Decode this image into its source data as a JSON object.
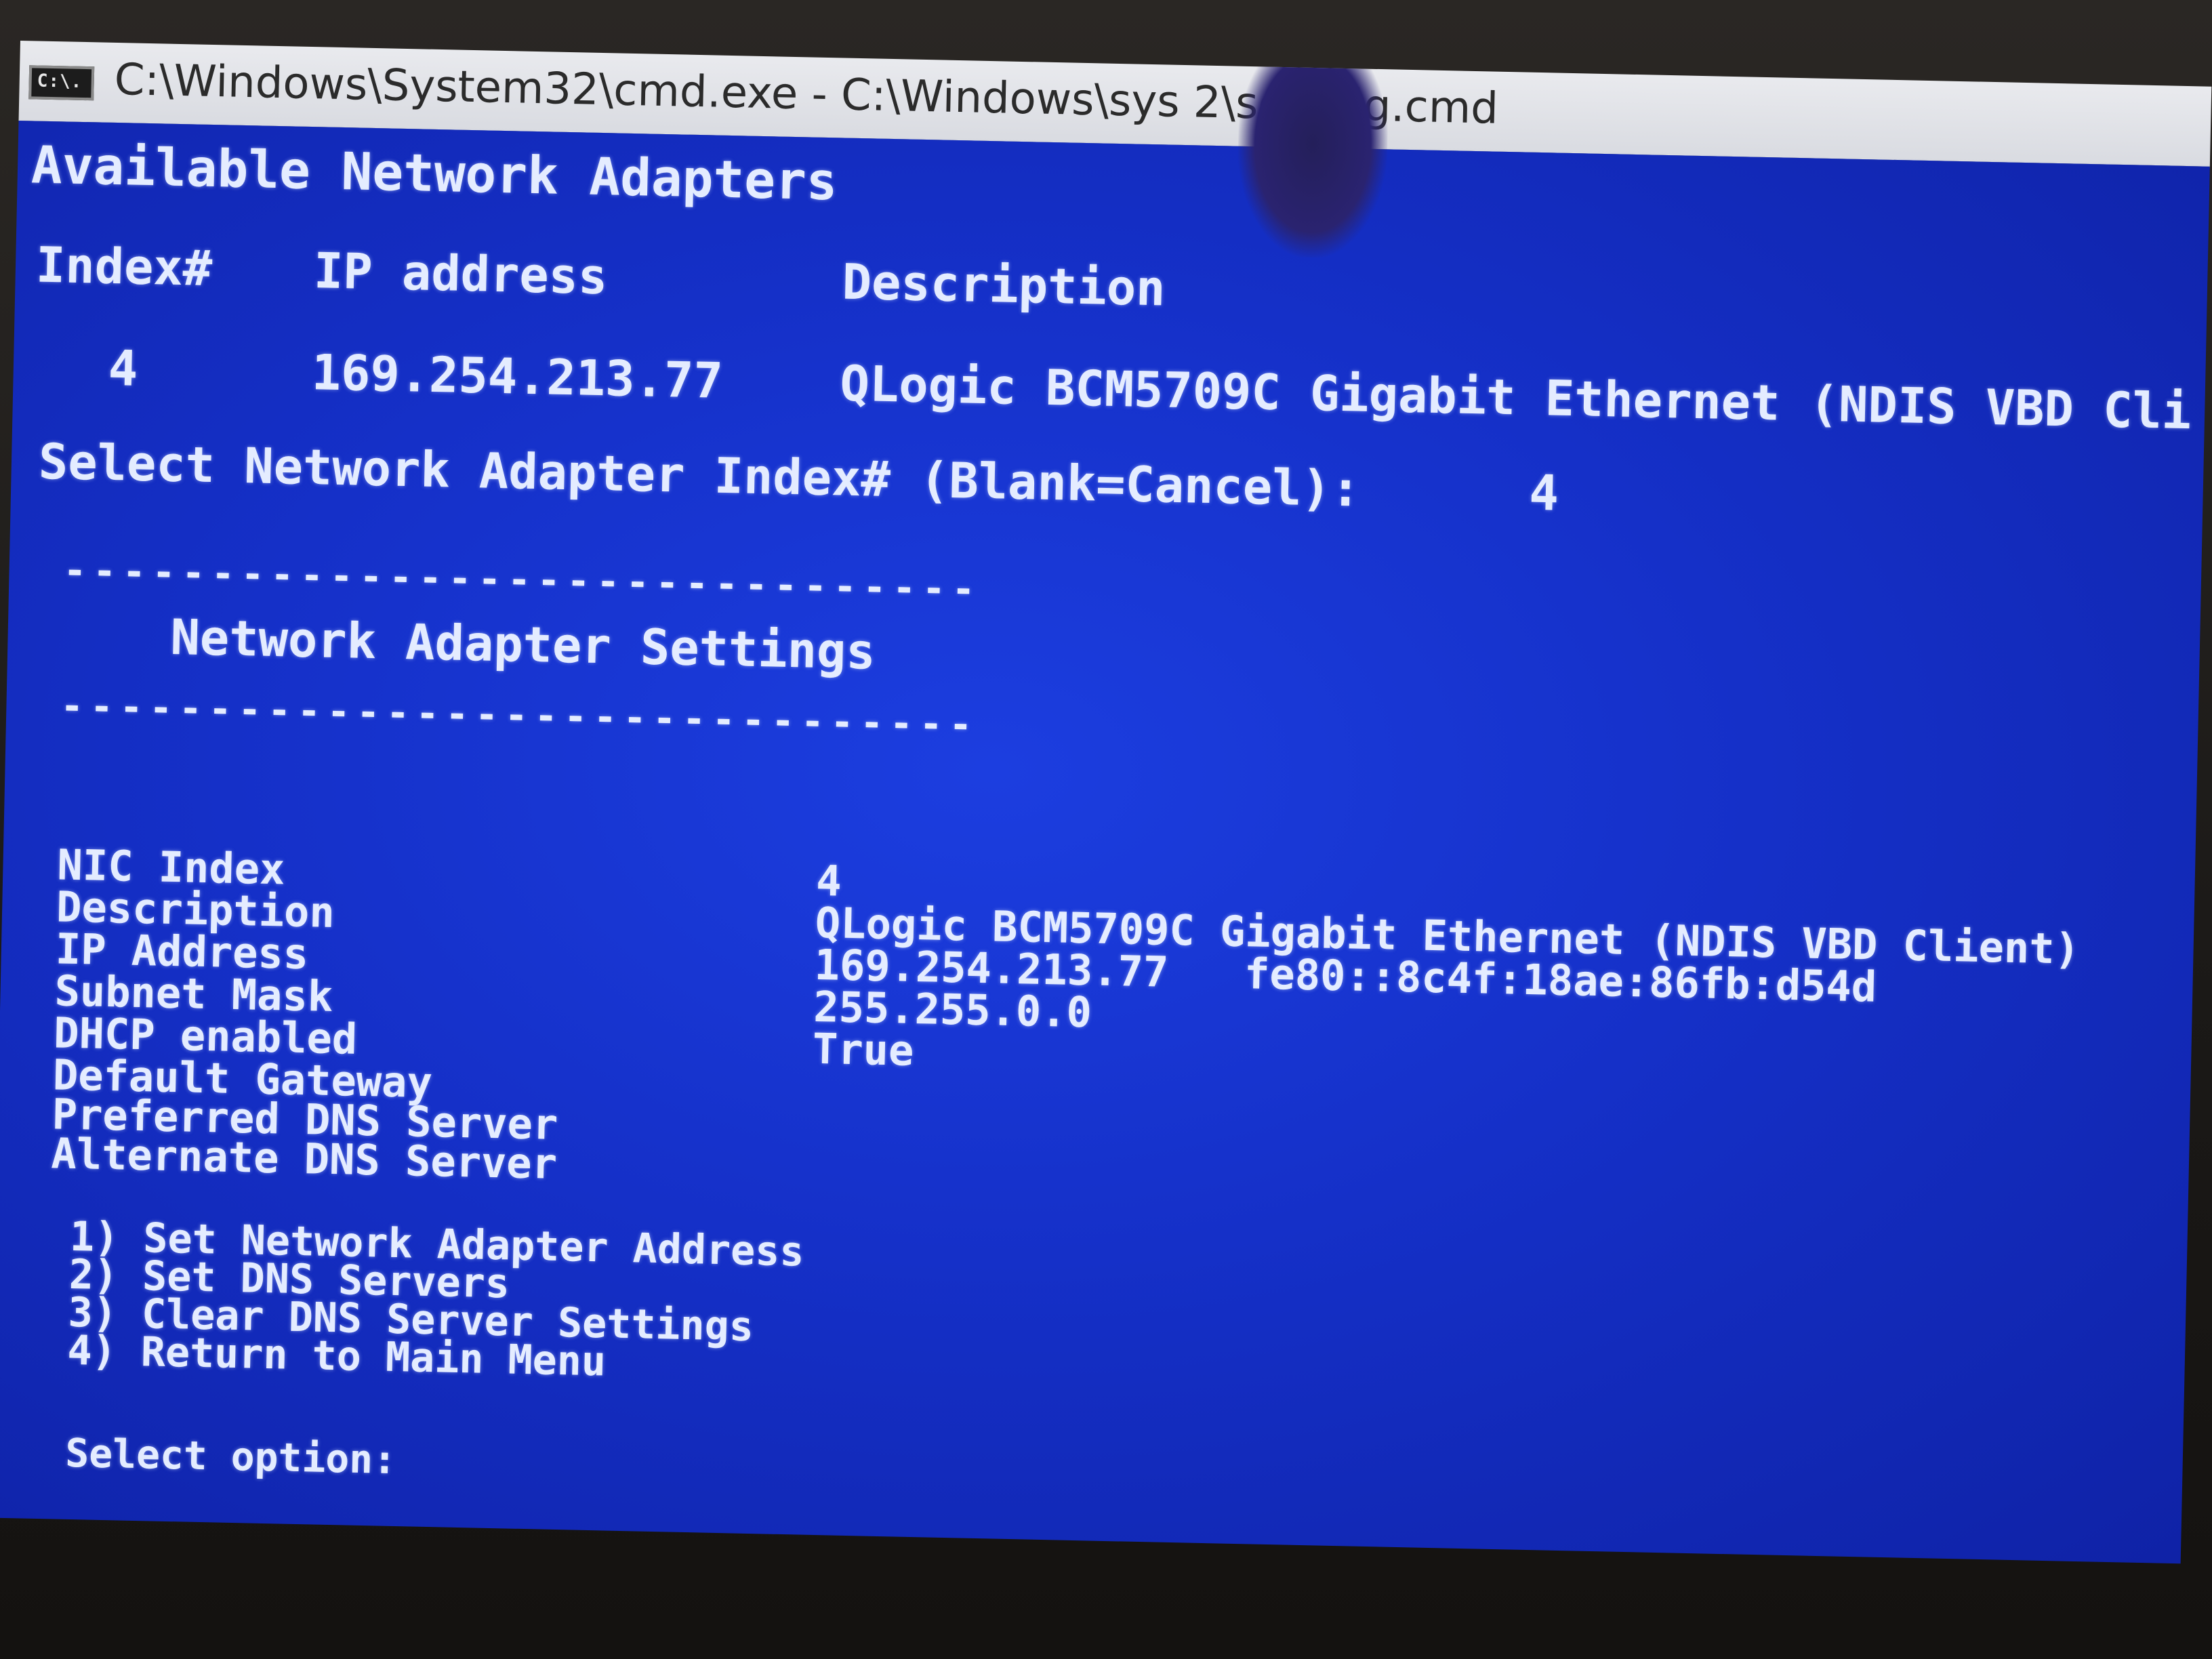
{
  "window": {
    "title": "C:\\Windows\\System32\\cmd.exe - C:\\Windows\\sys    2\\sconfig.cmd",
    "icon": "cmd-icon",
    "icon_text": "C:\\."
  },
  "console": {
    "heading": "Available Network Adapters",
    "table_headers": [
      "Index#",
      "IP address",
      "Description"
    ],
    "adapter_row": {
      "index": "4",
      "ip": "169.254.213.77",
      "description": "QLogic BCM5709C Gigabit Ethernet (NDIS VBD Cli"
    },
    "select_prompt": "Select Network Adapter Index# (Blank=Cancel):",
    "select_value": "4",
    "separator": "-------------------------------",
    "settings_title": "Network Adapter Settings",
    "settings": [
      {
        "label": "NIC Index",
        "value": "4"
      },
      {
        "label": "Description",
        "value": "QLogic BCM5709C Gigabit Ethernet (NDIS VBD Client)"
      },
      {
        "label": "IP Address",
        "value": "169.254.213.77   fe80::8c4f:18ae:86fb:d54d"
      },
      {
        "label": "Subnet Mask",
        "value": "255.255.0.0"
      },
      {
        "label": "DHCP enabled",
        "value": "True"
      },
      {
        "label": "Default Gateway",
        "value": ""
      },
      {
        "label": "Preferred DNS Server",
        "value": ""
      },
      {
        "label": "Alternate DNS Server",
        "value": ""
      }
    ],
    "menu": [
      "1) Set Network Adapter Address",
      "2) Set DNS Servers",
      "3) Clear DNS Server Settings",
      "4) Return to Main Menu"
    ],
    "option_prompt": "Select option:"
  }
}
